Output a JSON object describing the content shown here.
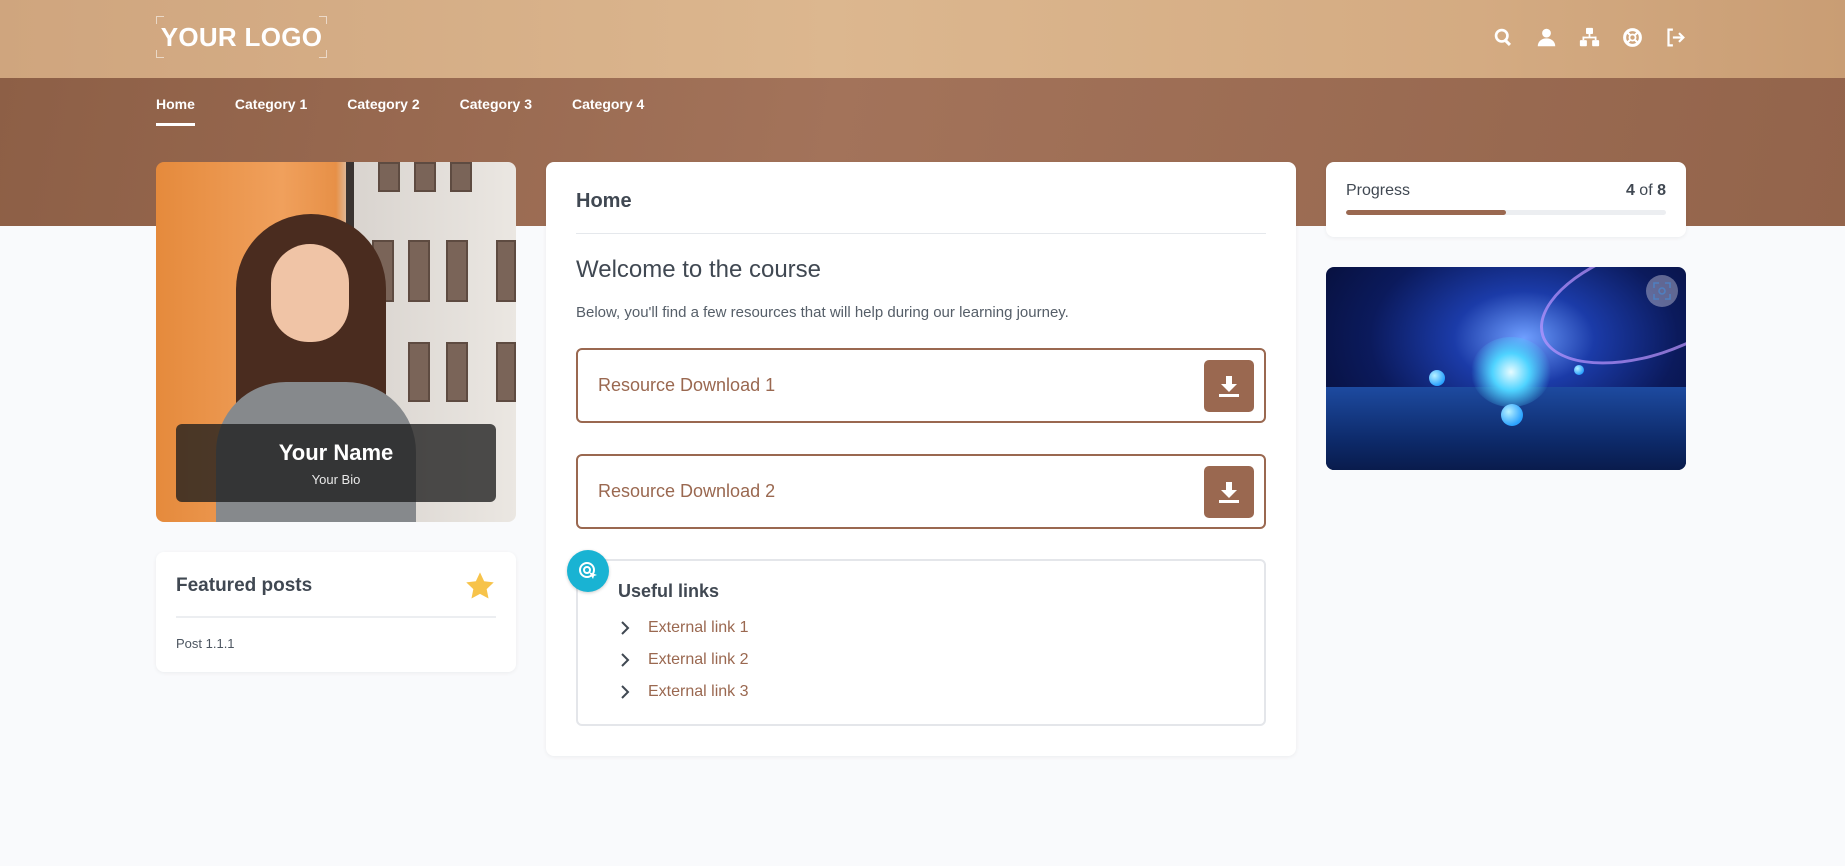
{
  "header": {
    "logo_text": "YOUR LOGO",
    "icons": [
      "search-icon",
      "user-icon",
      "sitemap-icon",
      "support-icon",
      "logout-icon"
    ]
  },
  "nav": {
    "items": [
      {
        "label": "Home",
        "active": true
      },
      {
        "label": "Category 1"
      },
      {
        "label": "Category 2"
      },
      {
        "label": "Category 3"
      },
      {
        "label": "Category 4"
      }
    ]
  },
  "profile": {
    "name": "Your Name",
    "bio": "Your Bio"
  },
  "featured": {
    "title": "Featured posts",
    "icon": "star-icon",
    "posts": [
      "Post 1.1.1"
    ]
  },
  "main": {
    "page_title": "Home",
    "heading": "Welcome to the course",
    "intro": "Below, you'll find a few resources that will help during our learning journey.",
    "resources": [
      {
        "label": "Resource Download 1"
      },
      {
        "label": "Resource Download 2"
      }
    ],
    "useful_links": {
      "title": "Useful links",
      "links": [
        "External link 1",
        "External link 2",
        "External link 3"
      ]
    }
  },
  "progress": {
    "label": "Progress",
    "current": "4",
    "of": "of",
    "total": "8",
    "fraction": 0.5
  },
  "colors": {
    "accent": "#9a6850",
    "badge": "#19b3d3",
    "star": "#f7c34a"
  }
}
